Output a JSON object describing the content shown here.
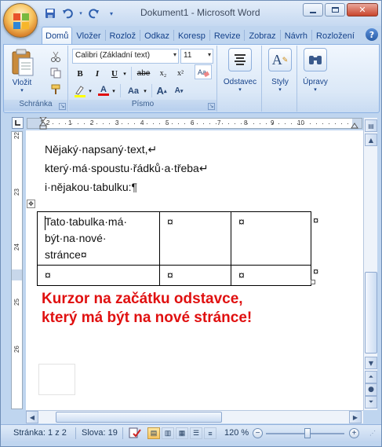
{
  "window": {
    "title": "Dokument1 - Microsoft Word",
    "controls": {
      "minimize": "–",
      "maximize": "□",
      "close": "✕"
    }
  },
  "quick_access": [
    "save-icon",
    "undo-icon",
    "redo-icon",
    "customize-icon"
  ],
  "ribbon": {
    "tabs": [
      "Domů",
      "Vložer",
      "Rozlož",
      "Odkaz",
      "Koresp",
      "Revize",
      "Zobraz",
      "Návrh",
      "Rozložení"
    ],
    "active_tab": "Domů",
    "help": "?",
    "clipboard": {
      "label": "Schránka",
      "paste_label": "Vložit"
    },
    "font": {
      "label": "Písmo",
      "font_name": "Calibri (Základní text)",
      "font_size": "11",
      "bold": "B",
      "italic": "I",
      "underline": "U",
      "strikethrough": "abe",
      "subscript": "x₂",
      "superscript": "x²",
      "change_case": "Aa",
      "grow": "A",
      "shrink": "A"
    },
    "paragraph": {
      "label": "Odstavec"
    },
    "styles": {
      "label": "Styly"
    },
    "editing": {
      "label": "Úpravy"
    }
  },
  "ruler": {
    "h_marks": [
      "1",
      "2",
      "1",
      "2",
      "3",
      "4",
      "5",
      "6",
      "7",
      "8",
      "9",
      "10"
    ],
    "v_marks": [
      "22",
      "23",
      "24",
      "25",
      "26"
    ]
  },
  "document": {
    "lines": [
      "Nějaký·napsaný·text,↵",
      "který·má·spoustu·řádků·a·třeba↵",
      "i·nějakou·tabulku:¶"
    ],
    "table": [
      [
        "Tato·tabulka·má·\nbýt·na·nové·\nstránce¤",
        "¤",
        "¤"
      ],
      [
        "¤",
        "¤",
        "¤"
      ]
    ],
    "row_end_mark": "¤",
    "annotation_line1": "Kurzor na začátku odstavce,",
    "annotation_line2": "který má být na nové stránce!"
  },
  "statusbar": {
    "page": "Stránka: 1 z 2",
    "words": "Slova: 19",
    "zoom": "120 %"
  },
  "colors": {
    "annotation": "#e01010",
    "ribbon_text": "#15428b",
    "accent": "#c3d9f3"
  }
}
